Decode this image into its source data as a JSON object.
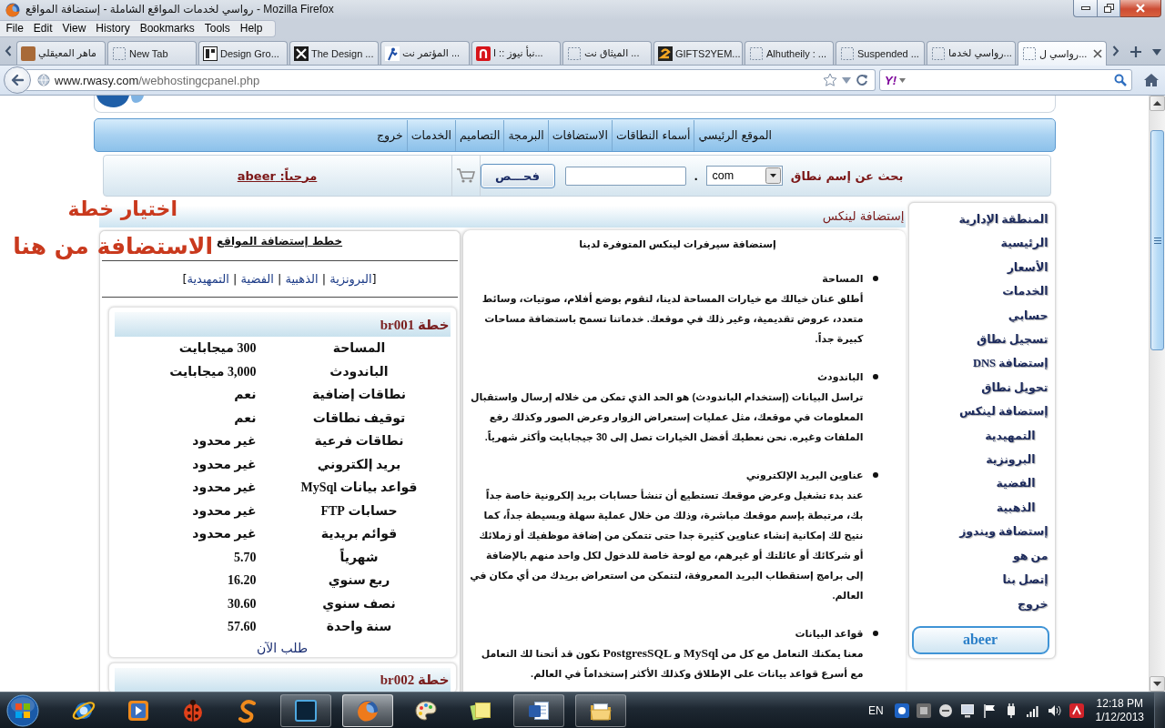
{
  "window": {
    "title": "رواسي لخدمات المواقع الشاملة - إستضافة المواقع - Mozilla Firefox"
  },
  "menu_bar": [
    "Help",
    "Tools",
    "Bookmarks",
    "History",
    "View",
    "Edit",
    "File"
  ],
  "tabs": [
    {
      "label": "رواسي ل...",
      "kind": "blank",
      "selected": true
    },
    {
      "label": "رواسي لخدما...",
      "kind": "blank",
      "selected": false
    },
    {
      "label": "Suspended ...",
      "kind": "blank",
      "selected": false
    },
    {
      "label": "Alhutheily : ...",
      "kind": "blank",
      "selected": false
    },
    {
      "label": "GIFTS2YEM...",
      "kind": "gift",
      "selected": false
    },
    {
      "label": "الميثاق نت ...",
      "kind": "blank",
      "selected": false
    },
    {
      "label": "نبأ نيوز :: ا...",
      "kind": "arch",
      "selected": false
    },
    {
      "label": "المؤتمر نت ...",
      "kind": "figure",
      "selected": false
    },
    {
      "label": "The Design ...",
      "kind": "cross",
      "selected": false
    },
    {
      "label": "Design Gro...",
      "kind": "mono",
      "selected": false
    },
    {
      "label": "New Tab",
      "kind": "blank",
      "selected": false
    },
    {
      "label": "ماهر المعيقلي",
      "kind": "photo",
      "selected": false
    }
  ],
  "address_bar": {
    "host": "www.rwasy.com",
    "path": "/webhostingcpanel.php",
    "search_engine": "Y!"
  },
  "site": {
    "nav": [
      "الموقع الرئيسي",
      "أسماء النطاقات",
      "الاستضافات",
      "البرمجة",
      "التصاميم",
      "الخدمات",
      "خروج"
    ],
    "domain_search": {
      "label": "بحث عن إسم نطاق",
      "tld": "com",
      "dot": ".",
      "button": "فحـــص",
      "greeting": "مرحباً: abeer"
    },
    "annotation": [
      "اختيار خطة",
      "الاستضافة من هنا"
    ],
    "section_title": "إستضافة لينكس",
    "plans": {
      "title": "خطط إستضافة المواقع",
      "filter": {
        "open": "[",
        "links": [
          "البرونزية",
          "الذهبية",
          "الفضية",
          "التمهيدية"
        ],
        "separator": "|",
        "close": "]"
      },
      "cards": [
        {
          "title": "خطة br001",
          "rows": [
            {
              "label": "المساحة",
              "value": "300 ميجابايت"
            },
            {
              "label": "الباندودث",
              "value": "3,000 ميجابايت"
            },
            {
              "label": "نطاقات إضافية",
              "value": "نعم"
            },
            {
              "label": "توقيف نطاقات",
              "value": "نعم"
            },
            {
              "label": "نطاقات فرعية",
              "value": "غير محدود"
            },
            {
              "label": "بريد إلكتروني",
              "value": "غير محدود"
            },
            {
              "label": "قواعد بيانات MySql",
              "value": "غير محدود"
            },
            {
              "label": "حسابات FTP",
              "value": "غير محدود"
            },
            {
              "label": "قوائم بريدية",
              "value": "غير محدود"
            },
            {
              "label": "شهرياً",
              "value": "5.70"
            },
            {
              "label": "ربع سنوي",
              "value": "16.20"
            },
            {
              "label": "نصف سنوي",
              "value": "30.60"
            },
            {
              "label": "سنة واحدة",
              "value": "57.60"
            }
          ],
          "order_link": "طلب الآن"
        },
        {
          "title": "خطة br002"
        }
      ]
    },
    "features": {
      "title": "إستضافة سيرفرات لينكس المتوفرة لدينا",
      "items": [
        {
          "title": "المساحة",
          "text": "أطلق عنان خيالك مع خيارات المساحة لدينا، لتقوم بوضع أفلام، صوتيات، وسائط متعدد، عروض تقديمية، وغير ذلك في موقعك. خدماتنا تسمح باستضافة مساحات كبيرة جداً."
        },
        {
          "title": "الباندودث",
          "text": "تراسل البيانات (إستخدام الباندودث) هو الحد الذي تمكن من خلاله إرسال واستقبال المعلومات في موقعك، مثل عمليات إستعراض الزوار وعرض الصور وكذلك رفع الملفات وغيره. نحن نعطيك أفضل الخيارات تصل إلى 30 جيجابايت وأكثر شهرياً."
        },
        {
          "title": "عناوين البريد الإلكتروني",
          "text": "عند بدء تشغيل وعرض موقعك تستطيع أن تنشأ حسابات بريد إلكرونية خاصة جداً بك، مرتبطة بإسم موقعك مباشرة، وذلك من خلال عملية سهلة وبسيطة جداً، كما نتيح لك إمكانية إنشاء عناوين كثيرة جدا حتى تتمكن من إضافة موظفيك أو زملائك أو شركائك أو عائلتك أو غيرهم، مع لوحة خاصة للدخول لكل واحد منهم بالإضافة إلى برامج إستقطاب البريد المعروفة، لتتمكن من استعراض بريدك من أي مكان في العالم."
        },
        {
          "title": "قواعد البيانات",
          "text": "معنا يمكنك التعامل مع كل من **MySql** و **PostgresSQL** نكون قد أتحنا لك التعامل مع أسرع قواعد بيانات على الإطلاق وكذلك الأكثر إستخداماً في العالم."
        }
      ]
    },
    "sidebar": {
      "items": [
        {
          "label": "المنطقة الإدارية"
        },
        {
          "label": "الرئيسية"
        },
        {
          "label": "الأسعار"
        },
        {
          "label": "الخدمات"
        },
        {
          "label": "حسابي"
        },
        {
          "label": "تسجيل نطاق"
        },
        {
          "label": "إستضافة DNS"
        },
        {
          "label": "تحويل نطاق"
        },
        {
          "label": "إستضافة لينكس",
          "children": [
            {
              "label": "التمهيدية"
            },
            {
              "label": "البرونزية"
            },
            {
              "label": "الفضية"
            },
            {
              "label": "الذهبية"
            }
          ]
        },
        {
          "label": "إستضافة ويندوز"
        },
        {
          "label": "من هو"
        },
        {
          "label": "إتصل بنا"
        },
        {
          "label": "خروج"
        }
      ],
      "user_button": "abeer"
    }
  },
  "taskbar": {
    "apps": [
      {
        "kind": "ie",
        "running": false,
        "selected": false
      },
      {
        "kind": "media",
        "running": false,
        "selected": false
      },
      {
        "kind": "ladybug",
        "running": false,
        "selected": false
      },
      {
        "kind": "swirl",
        "running": false,
        "selected": false
      },
      {
        "kind": "photoshop",
        "running": true,
        "selected": false
      },
      {
        "kind": "firefox",
        "running": true,
        "selected": true
      },
      {
        "kind": "paint",
        "running": false,
        "selected": false
      },
      {
        "kind": "notes",
        "running": false,
        "selected": false
      },
      {
        "kind": "word",
        "running": true,
        "selected": false
      },
      {
        "kind": "explorer",
        "running": true,
        "selected": false
      }
    ],
    "language": "EN",
    "time": "12:18 PM",
    "date": "1/12/2013"
  }
}
